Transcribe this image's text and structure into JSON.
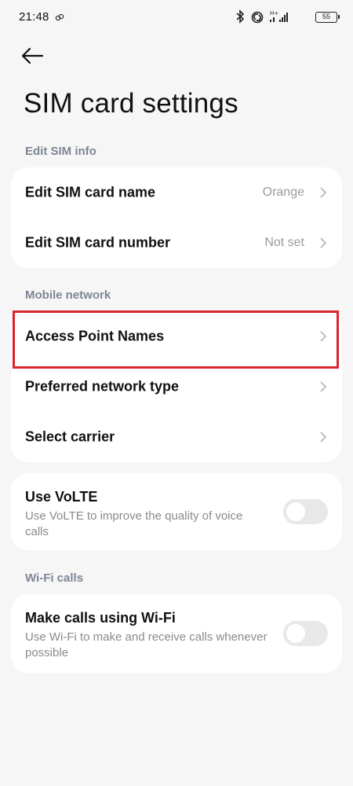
{
  "status_bar": {
    "time": "21:48",
    "battery": "55",
    "network": "H+"
  },
  "header": {
    "back_icon": "arrow-left-icon",
    "title": "SIM card settings"
  },
  "sections": {
    "edit_sim_info": {
      "header": "Edit SIM info",
      "items": [
        {
          "label": "Edit SIM card name",
          "value": "Orange"
        },
        {
          "label": "Edit SIM card number",
          "value": "Not set"
        }
      ]
    },
    "mobile_network": {
      "header": "Mobile network",
      "items": [
        {
          "label": "Access Point Names"
        },
        {
          "label": "Preferred network type"
        },
        {
          "label": "Select carrier"
        }
      ]
    },
    "volte": {
      "title": "Use VoLTE",
      "description": "Use VoLTE to improve the quality of voice calls",
      "enabled": false
    },
    "wifi_calls": {
      "header": "Wi-Fi calls",
      "title": "Make calls using Wi-Fi",
      "description": "Use Wi-Fi to make and receive calls whenever possible",
      "enabled": false
    }
  },
  "colors": {
    "background": "#f6f6f6",
    "card": "#ffffff",
    "section_header": "#7d8596",
    "highlight": "#d9242e",
    "toggle_off": "#e8e8e8"
  }
}
